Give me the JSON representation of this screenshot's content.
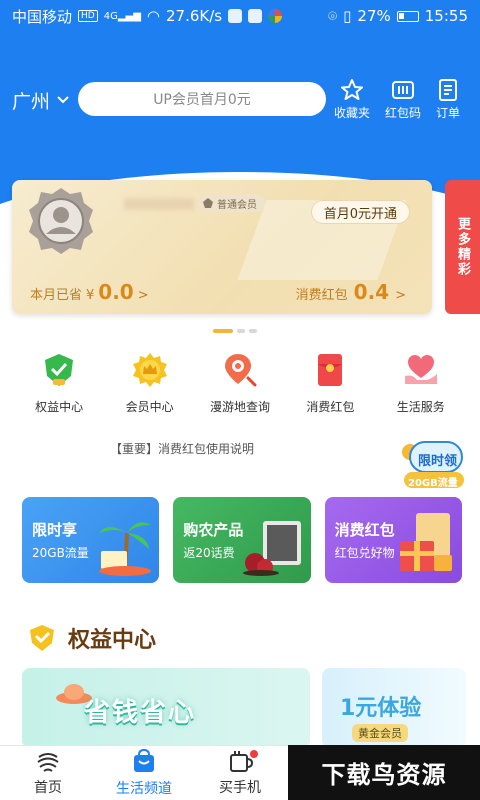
{
  "status_bar": {
    "carrier": "中国移动",
    "net_chip": "HD",
    "signal_type": "4G",
    "speed": "27.6K/s",
    "battery": "27%",
    "time": "15:55"
  },
  "header": {
    "city": "广州",
    "search_placeholder": "UP会员首月0元",
    "actions": [
      {
        "label": "收藏夹",
        "icon": "star-icon"
      },
      {
        "label": "红包码",
        "icon": "barcode-icon"
      },
      {
        "label": "订单",
        "icon": "order-list-icon"
      }
    ]
  },
  "member_card": {
    "level": "普通会员",
    "open_button": "首月0元开通",
    "saved_label": "本月已省",
    "saved_currency": "¥",
    "saved_value": "0.0",
    "saved_arrow": ">",
    "redpack_label": "消费红包",
    "redpack_value": "0.4",
    "redpack_arrow": ">"
  },
  "more_tab": "更多精彩",
  "carousel": {
    "total": 3,
    "active": 0
  },
  "services": [
    {
      "label": "权益中心",
      "icon": "rights-shield-icon"
    },
    {
      "label": "会员中心",
      "icon": "crown-medal-icon"
    },
    {
      "label": "漫游地查询",
      "icon": "location-search-icon"
    },
    {
      "label": "消费红包",
      "icon": "red-envelope-icon"
    },
    {
      "label": "生活服务",
      "icon": "heart-hand-icon"
    }
  ],
  "notice": "【重要】消费红包使用说明",
  "promo_badge": {
    "line1": "限时领",
    "line2": "20GB流量"
  },
  "promos": [
    {
      "title": "限时享",
      "subtitle": "20GB流量",
      "color": "#3d97f0"
    },
    {
      "title": "购农产品",
      "subtitle": "返20话费",
      "color": "#3fae59"
    },
    {
      "title": "消费红包",
      "subtitle": "红包兑好物",
      "color": "#9b5ce6"
    }
  ],
  "section": {
    "title": "权益中心"
  },
  "benefits": [
    {
      "text": "省钱省心"
    },
    {
      "text": "1元体验",
      "sub": "黄金会员"
    }
  ],
  "bottom_nav": [
    {
      "label": "首页",
      "icon": "home-logo-icon",
      "active": false
    },
    {
      "label": "生活频道",
      "icon": "shopping-bag-icon",
      "active": true
    },
    {
      "label": "买手机",
      "icon": "phone-cup-icon",
      "active": false
    }
  ],
  "watermark": "下载鸟资源",
  "colors": {
    "primary": "#1d7ff0",
    "gold": "#d98a1b",
    "red": "#ef4b49"
  }
}
